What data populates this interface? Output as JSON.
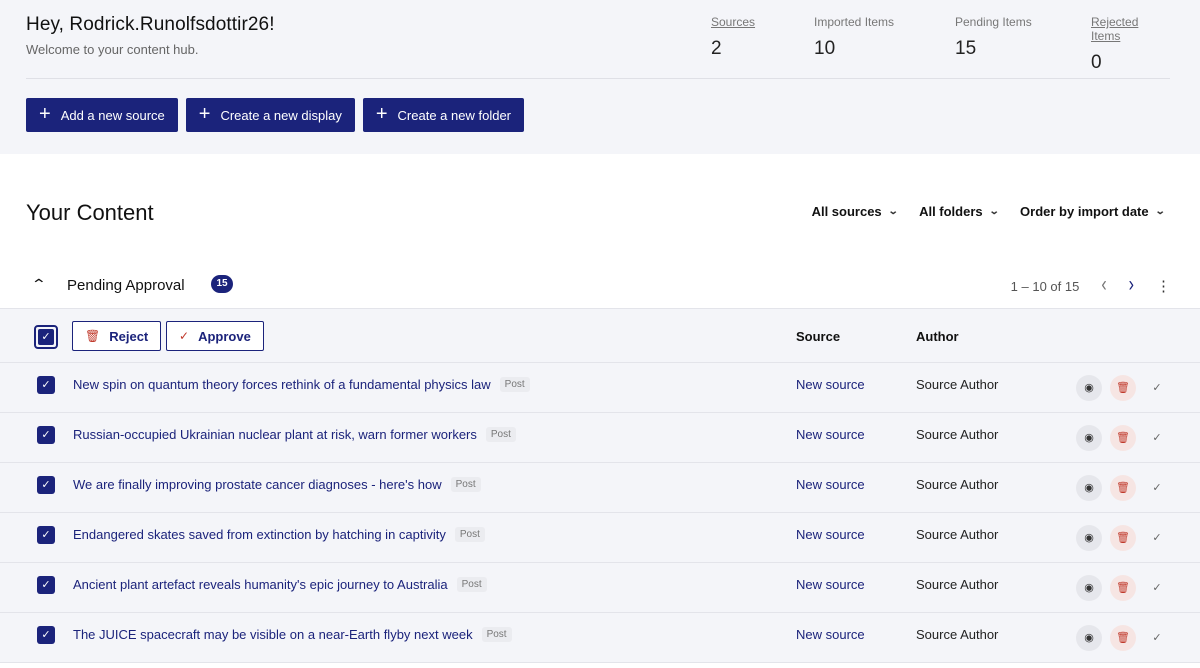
{
  "header": {
    "greeting": "Hey, Rodrick.Runolfsdottir26!",
    "subtitle": "Welcome to your content hub.",
    "stats": [
      {
        "label": "Sources",
        "value": "2"
      },
      {
        "label": "Imported Items",
        "value": "10"
      },
      {
        "label": "Pending Items",
        "value": "15"
      },
      {
        "label": "Rejected Items",
        "value": "0"
      }
    ],
    "actions": [
      {
        "label": "Add a new source",
        "icon": "plus-icon"
      },
      {
        "label": "Create a new display",
        "icon": "plus-icon"
      },
      {
        "label": "Create a new folder",
        "icon": "plus-icon"
      }
    ]
  },
  "content": {
    "title": "Your Content",
    "filters": [
      {
        "label": "All sources",
        "icon": "chevron-down-icon"
      },
      {
        "label": "All folders",
        "icon": "chevron-down-icon"
      },
      {
        "label": "Order by import date",
        "icon": "chevron-down-icon"
      }
    ]
  },
  "section": {
    "title": "Pending Approval",
    "count": "15",
    "pagination": "1 – 10 of 15",
    "bulk": {
      "reject_label": "Reject",
      "approve_label": "Approve"
    },
    "columns": {
      "source": "Source",
      "author": "Author"
    },
    "rows": [
      {
        "title": "New spin on quantum theory forces rethink of a fundamental physics law",
        "tag": "Post",
        "source": "New source",
        "author": "Source Author"
      },
      {
        "title": "Russian-occupied Ukrainian nuclear plant at risk, warn former workers",
        "tag": "Post",
        "source": "New source",
        "author": "Source Author"
      },
      {
        "title": "We are finally improving prostate cancer diagnoses - here's how",
        "tag": "Post",
        "source": "New source",
        "author": "Source Author"
      },
      {
        "title": "Endangered skates saved from extinction by hatching in captivity",
        "tag": "Post",
        "source": "New source",
        "author": "Source Author"
      },
      {
        "title": "Ancient plant artefact reveals humanity's epic journey to Australia",
        "tag": "Post",
        "source": "New source",
        "author": "Source Author"
      },
      {
        "title": "The JUICE spacecraft may be visible on a near-Earth flyby next week",
        "tag": "Post",
        "source": "New source",
        "author": "Source Author"
      }
    ]
  },
  "colors": {
    "brand": "#1b237b",
    "danger": "#c0392b",
    "panel_bg": "#f4f5f9"
  }
}
